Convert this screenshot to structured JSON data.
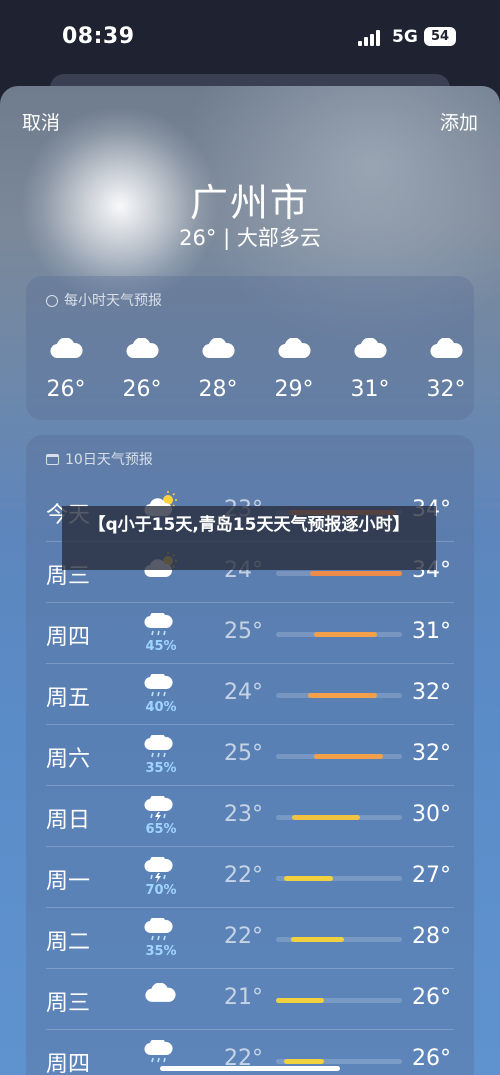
{
  "status": {
    "time": "08:39",
    "network": "5G",
    "battery": "54"
  },
  "nav": {
    "cancel": "取消",
    "add": "添加"
  },
  "location": {
    "city": "广州市",
    "condition": "26° | 大部多云"
  },
  "hourly": {
    "header": "每小时天气预报",
    "items": [
      {
        "temp": "26°",
        "icon": "cloud-icon"
      },
      {
        "temp": "26°",
        "icon": "cloud-icon"
      },
      {
        "temp": "28°",
        "icon": "cloud-icon"
      },
      {
        "temp": "29°",
        "icon": "cloud-icon"
      },
      {
        "temp": "31°",
        "icon": "cloud-icon"
      },
      {
        "temp": "32°",
        "icon": "cloud-icon"
      }
    ]
  },
  "daily": {
    "header": "10日天气预报",
    "rows": [
      {
        "day": "今天",
        "icon": "partly-sunny-icon",
        "precip": "",
        "low": "23°",
        "high": "34°",
        "bar_start": 0.1,
        "bar_end": 0.95,
        "bar_color": "#f08c4a"
      },
      {
        "day": "周三",
        "icon": "partly-sunny-icon",
        "precip": "",
        "low": "24°",
        "high": "34°",
        "bar_start": 0.27,
        "bar_end": 1.0,
        "bar_color": "#f08c4a"
      },
      {
        "day": "周四",
        "icon": "rain-cloud-icon",
        "precip": "45%",
        "low": "25°",
        "high": "31°",
        "bar_start": 0.3,
        "bar_end": 0.8,
        "bar_color": "#f3a04a"
      },
      {
        "day": "周五",
        "icon": "rain-cloud-icon",
        "precip": "40%",
        "low": "24°",
        "high": "32°",
        "bar_start": 0.25,
        "bar_end": 0.8,
        "bar_color": "#f3a04a"
      },
      {
        "day": "周六",
        "icon": "rain-cloud-icon",
        "precip": "35%",
        "low": "25°",
        "high": "32°",
        "bar_start": 0.3,
        "bar_end": 0.85,
        "bar_color": "#f3a04a"
      },
      {
        "day": "周日",
        "icon": "thunder-rain-icon",
        "precip": "65%",
        "low": "23°",
        "high": "30°",
        "bar_start": 0.13,
        "bar_end": 0.67,
        "bar_color": "#f2c340"
      },
      {
        "day": "周一",
        "icon": "thunder-rain-icon",
        "precip": "70%",
        "low": "22°",
        "high": "27°",
        "bar_start": 0.06,
        "bar_end": 0.45,
        "bar_color": "#f2d13e"
      },
      {
        "day": "周二",
        "icon": "rain-cloud-icon",
        "precip": "35%",
        "low": "22°",
        "high": "28°",
        "bar_start": 0.12,
        "bar_end": 0.54,
        "bar_color": "#f2d13e"
      },
      {
        "day": "周三",
        "icon": "cloud-icon",
        "precip": "",
        "low": "21°",
        "high": "26°",
        "bar_start": 0.0,
        "bar_end": 0.38,
        "bar_color": "#f2d13e"
      },
      {
        "day": "周四",
        "icon": "rain-cloud-icon",
        "precip": "",
        "low": "22°",
        "high": "26°",
        "bar_start": 0.06,
        "bar_end": 0.38,
        "bar_color": "#f2d13e"
      }
    ]
  },
  "overlay_caption": "【q小于15天,青岛15天天气预报逐小时】"
}
